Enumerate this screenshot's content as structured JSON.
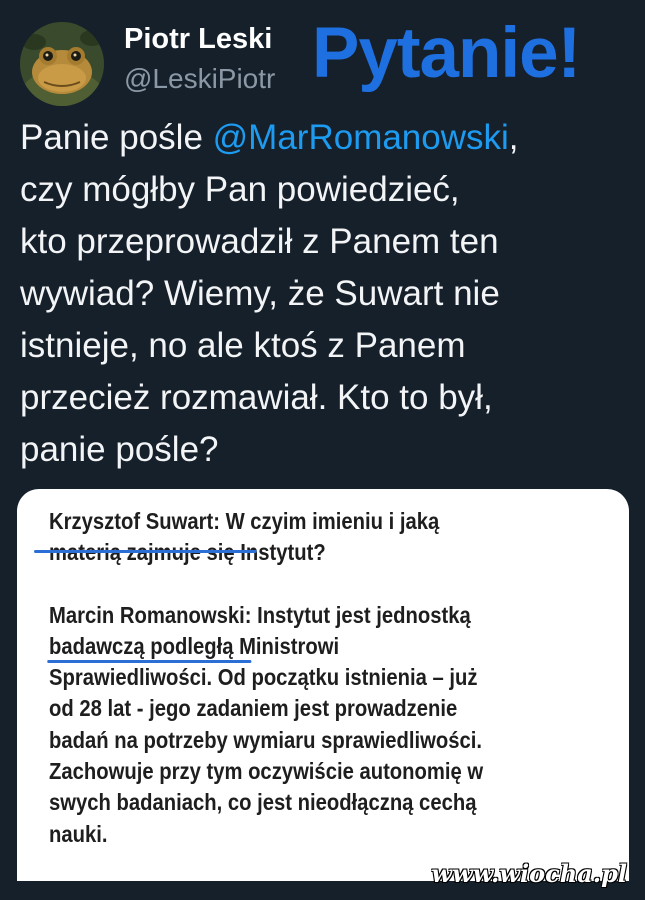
{
  "author": {
    "display_name": "Piotr Leski",
    "handle": "@LeskiPiotr"
  },
  "banner_text": "Pytanie!",
  "tweet": {
    "line1_prefix": "Panie pośle ",
    "mention": "@MarRomanowski",
    "line1_suffix": ",",
    "lines": [
      "czy mógłby Pan powiedzieć,",
      "kto przeprowadził z Panem ten",
      "wywiad? Wiemy, że Suwart nie",
      "istnieje, no ale ktoś z Panem",
      "przecież rozmawiał. Kto to był,",
      "panie pośle?"
    ]
  },
  "quote": {
    "q_speaker": "Krzysztof Suwart:",
    "q_line1": "W czyim imieniu i jaką",
    "q_line2": "materią zajmuje się Instytut?",
    "a_speaker": "Marcin Romanowski:",
    "a_line1": "Instytut jest jednostką",
    "a_lines": [
      "badawczą podległą Ministrowi",
      "Sprawiedliwości. Od początku istnienia – już",
      "od 28 lat - jego zadaniem jest prowadzenie",
      "badań na potrzeby wymiaru sprawiedliwości.",
      "Zachowuje przy tym oczywiście autonomię w",
      "swych badaniach, co jest nieodłączną cechą",
      "nauki."
    ]
  },
  "watermark": "www.wiocha.pl",
  "colors": {
    "background": "#15202b",
    "mention": "#1d9bf0",
    "banner": "#1e6fe0",
    "underline": "#2b6fd6"
  }
}
